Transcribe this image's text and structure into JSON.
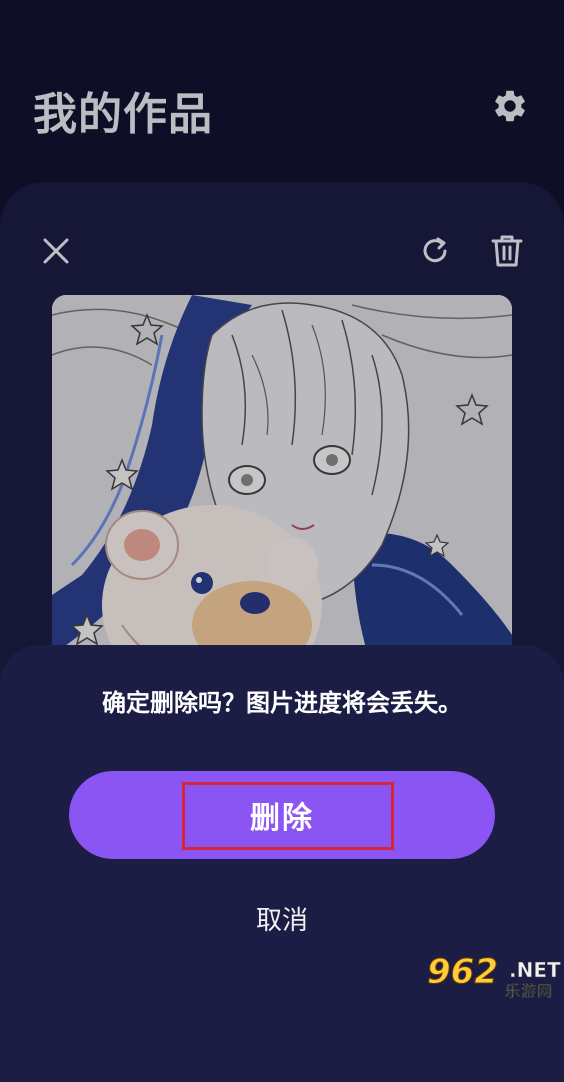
{
  "header": {
    "title": "我的作品",
    "settings_icon": "gear-icon"
  },
  "artwork_card": {
    "close_icon": "close-icon",
    "restart_icon": "refresh-icon",
    "delete_icon": "trash-icon",
    "artwork_image": "coloring-artwork-girl-with-teddy-bear"
  },
  "dialog": {
    "message": "确定删除吗？图片进度将会丢失。",
    "confirm_label": "删除",
    "cancel_label": "取消"
  },
  "watermark": {
    "number": "962",
    "domain": ".NET",
    "site_name": "乐游网"
  },
  "colors": {
    "background": "#121230",
    "card": "#1c1d44",
    "accent": "#8a55f2",
    "highlight": "#d8243a"
  }
}
